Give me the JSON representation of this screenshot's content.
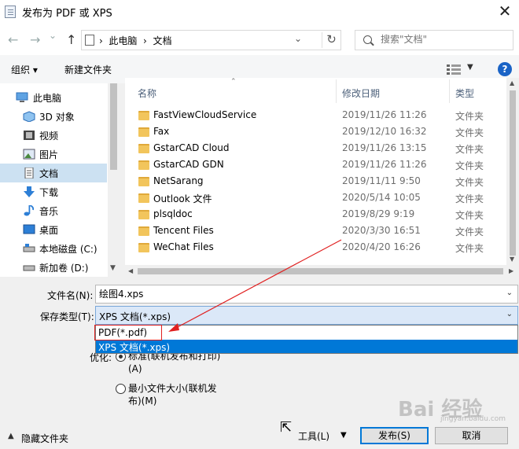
{
  "window": {
    "title": "发布为 PDF 或 XPS",
    "close": "✕"
  },
  "nav": {
    "back": "←",
    "forward": "→",
    "recent": "⌄",
    "up": "↑",
    "breadcrumb": "›  此电脑  ›  文档",
    "refresh": "↻",
    "search_placeholder": "搜索\"文档\""
  },
  "toolbar": {
    "organize": "组织 ▾",
    "new_folder": "新建文件夹",
    "help": "?"
  },
  "sidebar": {
    "items": [
      {
        "label": "此电脑",
        "icon": "computer-icon"
      },
      {
        "label": "3D 对象",
        "icon": "3d-objects-icon"
      },
      {
        "label": "视频",
        "icon": "video-icon"
      },
      {
        "label": "图片",
        "icon": "pictures-icon"
      },
      {
        "label": "文档",
        "icon": "documents-icon",
        "selected": true
      },
      {
        "label": "下载",
        "icon": "download-icon"
      },
      {
        "label": "音乐",
        "icon": "music-icon"
      },
      {
        "label": "桌面",
        "icon": "desktop-icon"
      },
      {
        "label": "本地磁盘 (C:)",
        "icon": "drive-icon"
      },
      {
        "label": "新加卷 (D:)",
        "icon": "drive-icon"
      }
    ]
  },
  "columns": {
    "name": "名称",
    "date": "修改日期",
    "type": "类型"
  },
  "files": [
    {
      "name": "FastViewCloudService",
      "date": "2019/11/26 11:26",
      "type": "文件夹"
    },
    {
      "name": "Fax",
      "date": "2019/12/10 16:32",
      "type": "文件夹"
    },
    {
      "name": "GstarCAD Cloud",
      "date": "2019/11/26 13:15",
      "type": "文件夹"
    },
    {
      "name": "GstarCAD GDN",
      "date": "2019/11/26 11:26",
      "type": "文件夹"
    },
    {
      "name": "NetSarang",
      "date": "2019/11/11 9:50",
      "type": "文件夹"
    },
    {
      "name": "Outlook 文件",
      "date": "2020/5/14 10:05",
      "type": "文件夹"
    },
    {
      "name": "plsqldoc",
      "date": "2019/8/29 9:19",
      "type": "文件夹"
    },
    {
      "name": "Tencent Files",
      "date": "2020/3/30 16:51",
      "type": "文件夹"
    },
    {
      "name": "WeChat Files",
      "date": "2020/4/20 16:26",
      "type": "文件夹"
    }
  ],
  "form": {
    "filename_label": "文件名(N):",
    "filename_value": "绘图4.xps",
    "filetype_label": "保存类型(T):",
    "filetype_value": "XPS 文档(*.xps)",
    "filetype_options": [
      "PDF(*.pdf)",
      "XPS 文档(*.xps)"
    ],
    "optimize_label": "优化:",
    "optimize_standard": "标准(联机发布和打印)",
    "optimize_standard_key": "(A)",
    "optimize_min_1": "最小文件大小(联机发",
    "optimize_min_2": "布)(M)"
  },
  "footer": {
    "hide_folders": "隐藏文件夹",
    "tools": "工具(L)",
    "publish": "发布(S)",
    "cancel": "取消"
  },
  "watermark": {
    "brand": "Bai 经验",
    "url": "jingyan.baidu.com"
  },
  "colors": {
    "accent": "#0078d7",
    "annotation": "#e02020",
    "selection": "#cce1f2"
  }
}
